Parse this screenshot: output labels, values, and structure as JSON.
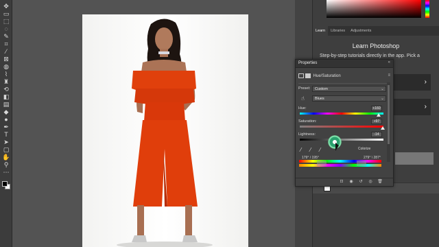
{
  "tools": [
    {
      "name": "move-tool-icon",
      "glyph": "✥"
    },
    {
      "name": "artboard-icon",
      "glyph": "▭"
    },
    {
      "name": "marquee-icon",
      "glyph": "⬚"
    },
    {
      "name": "lasso-icon",
      "glyph": "◌"
    },
    {
      "name": "quick-select-icon",
      "glyph": "✎"
    },
    {
      "name": "crop-icon",
      "glyph": "⌗"
    },
    {
      "name": "eyedropper-tool-icon",
      "glyph": "⁄"
    },
    {
      "name": "frame-icon",
      "glyph": "⊠"
    },
    {
      "name": "healing-brush-icon",
      "glyph": "◍"
    },
    {
      "name": "brush-icon",
      "glyph": "⌇"
    },
    {
      "name": "clone-stamp-icon",
      "glyph": "♜"
    },
    {
      "name": "history-brush-icon",
      "glyph": "⟲"
    },
    {
      "name": "eraser-icon",
      "glyph": "◧"
    },
    {
      "name": "gradient-icon",
      "glyph": "▤"
    },
    {
      "name": "blur-icon",
      "glyph": "◆"
    },
    {
      "name": "dodge-icon",
      "glyph": "●"
    },
    {
      "name": "pen-icon",
      "glyph": "✒"
    },
    {
      "name": "type-icon",
      "glyph": "T"
    },
    {
      "name": "path-select-icon",
      "glyph": "➤"
    },
    {
      "name": "rectangle-icon",
      "glyph": "▢"
    },
    {
      "name": "hand-icon",
      "glyph": "✋"
    },
    {
      "name": "zoom-icon",
      "glyph": "⚲"
    },
    {
      "name": "more-tools-icon",
      "glyph": "⋯"
    }
  ],
  "learn": {
    "tabs": [
      "Learn",
      "Libraries",
      "Adjustments"
    ],
    "title": "Learn Photoshop",
    "subtitle": "Step-by-step tutorials directly in the app. Pick a",
    "card_arrow": "›"
  },
  "properties": {
    "title": "Properties",
    "collapse": "«",
    "menu": "≡",
    "type_label": "Hue/Saturation",
    "preset_label": "Preset:",
    "preset_value": "Custom",
    "channel_value": "Blues",
    "hue_label": "Hue:",
    "hue_value": "+160",
    "hue_level": 0.94,
    "saturation_label": "Saturation:",
    "saturation_value": "+97",
    "saturation_level": 0.99,
    "lightness_label": "Lightness:",
    "lightness_value": "-14",
    "lightness_level": 0.43,
    "colorize_label": "Colorize",
    "range_left": "179° / 195°",
    "range_right": "279° \\ 287°"
  }
}
